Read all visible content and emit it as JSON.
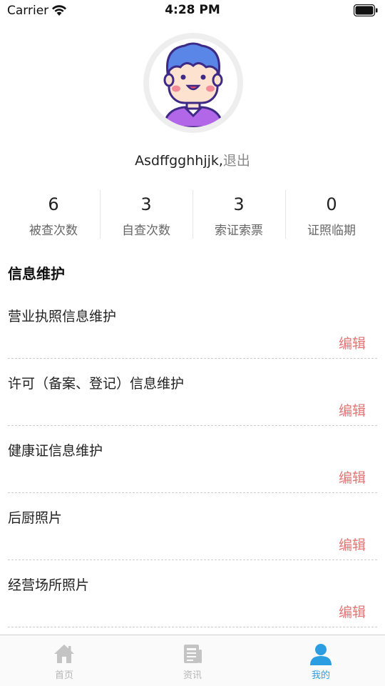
{
  "status_bar": {
    "carrier": "Carrier",
    "time": "4:28 PM"
  },
  "profile": {
    "username": "Asdffgghhjjk,",
    "logout_label": "退出"
  },
  "stats": [
    {
      "value": "6",
      "label": "被查次数"
    },
    {
      "value": "3",
      "label": "自查次数"
    },
    {
      "value": "3",
      "label": "索证索票"
    },
    {
      "value": "0",
      "label": "证照临期"
    }
  ],
  "section": {
    "title": "信息维护"
  },
  "items": [
    {
      "label": "营业执照信息维护",
      "action": "编辑"
    },
    {
      "label": "许可（备案、登记）信息维护",
      "action": "编辑"
    },
    {
      "label": "健康证信息维护",
      "action": "编辑"
    },
    {
      "label": "后厨照片",
      "action": "编辑"
    },
    {
      "label": "经营场所照片",
      "action": "编辑"
    }
  ],
  "tabs": [
    {
      "label": "首页",
      "icon": "home-icon",
      "active": false
    },
    {
      "label": "资讯",
      "icon": "news-icon",
      "active": false
    },
    {
      "label": "我的",
      "icon": "user-icon",
      "active": true
    }
  ],
  "colors": {
    "accent": "#2a9ee0",
    "edit": "#e57373",
    "inactive": "#b5b5b5"
  }
}
